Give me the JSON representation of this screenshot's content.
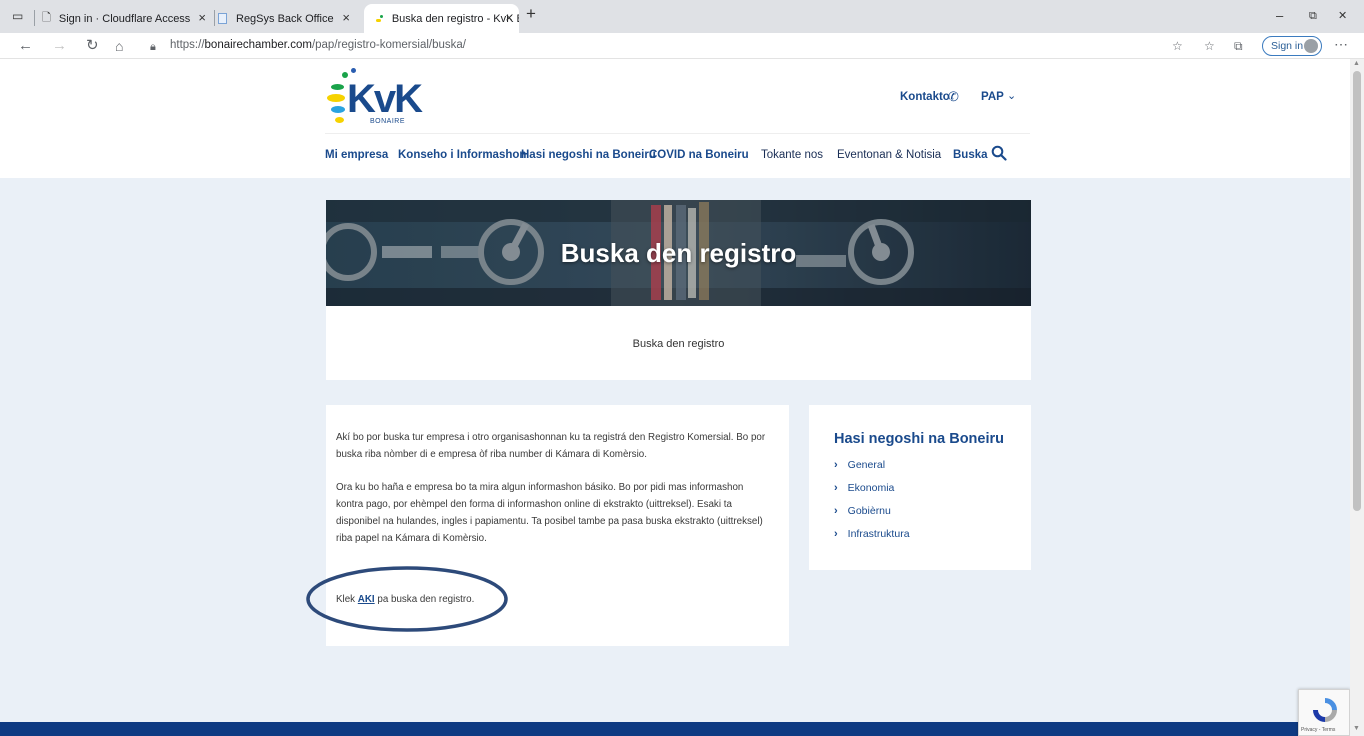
{
  "browser": {
    "tabs": [
      {
        "title": "Sign in · Cloudflare Access",
        "active": false
      },
      {
        "title": "RegSys Back Office",
        "active": false
      },
      {
        "title": "Buska den registro - KvK Bonaire",
        "active": true
      }
    ],
    "new_tab_label": "+",
    "url_prefix": "https://",
    "url_domain": "bonairechamber.com",
    "url_path": "/pap/registro-komersial/buska/",
    "sign_in_label": "Sign in",
    "window_minimize": "–",
    "window_restore": "⧉",
    "window_close": "✕"
  },
  "header": {
    "logo_text": "KvK",
    "logo_sub": "BONAIRE",
    "contact_label": "Kontakto",
    "language_label": "PAP",
    "menu": [
      {
        "label": "Mi empresa"
      },
      {
        "label": "Konseho i Informashon"
      },
      {
        "label": "Hasi negoshi na Boneiru"
      },
      {
        "label": "COVID na Boneiru"
      },
      {
        "label": "Tokante nos"
      },
      {
        "label": "Eventonan & Notisia"
      },
      {
        "label": "Buska"
      }
    ]
  },
  "hero": {
    "title": "Buska den registro"
  },
  "subtitle": "Buska den registro",
  "content": {
    "paragraph1": "Akí bo por buska tur empresa i otro organisashonnan ku ta registrá den Registro Komersial. Bo por buska riba nòmber di e empresa òf riba number di Kámara di Komèrsio.",
    "paragraph2": "Ora ku bo haña e empresa bo ta mira algun informashon básiko. Bo por pidi mas informashon kontra pago, por ehèmpel den forma di informashon online di ekstrakto (uittreksel). Esaki ta disponibel na hulandes, ingles i papiamentu. Ta posibel tambe pa pasa buska ekstrakto (uittreksel) riba papel na Kámara di Komèrsio.",
    "klek_before": "Klek ",
    "klek_link": "AKI",
    "klek_after": " pa buska den registro."
  },
  "sidebar": {
    "title": "Hasi negoshi na Boneiru",
    "items": [
      {
        "label": "General"
      },
      {
        "label": "Ekonomia"
      },
      {
        "label": "Gobièrnu"
      },
      {
        "label": "Infrastruktura"
      }
    ]
  },
  "recaptcha": {
    "text": "Privacy - Terms"
  },
  "colors": {
    "brand_blue": "#1a4a8c",
    "footer_blue": "#0e3a82",
    "page_bg": "#eaf0f7",
    "annotation_ellipse": "#2d4a7a"
  },
  "icons": [
    "sidebar-toggle-icon",
    "page-icon",
    "favicon",
    "back-icon",
    "forward-icon",
    "refresh-icon",
    "home-icon",
    "lock-icon",
    "phone-icon",
    "chevron-down-icon",
    "search-icon",
    "chevron-right-icon",
    "recaptcha-icon"
  ]
}
